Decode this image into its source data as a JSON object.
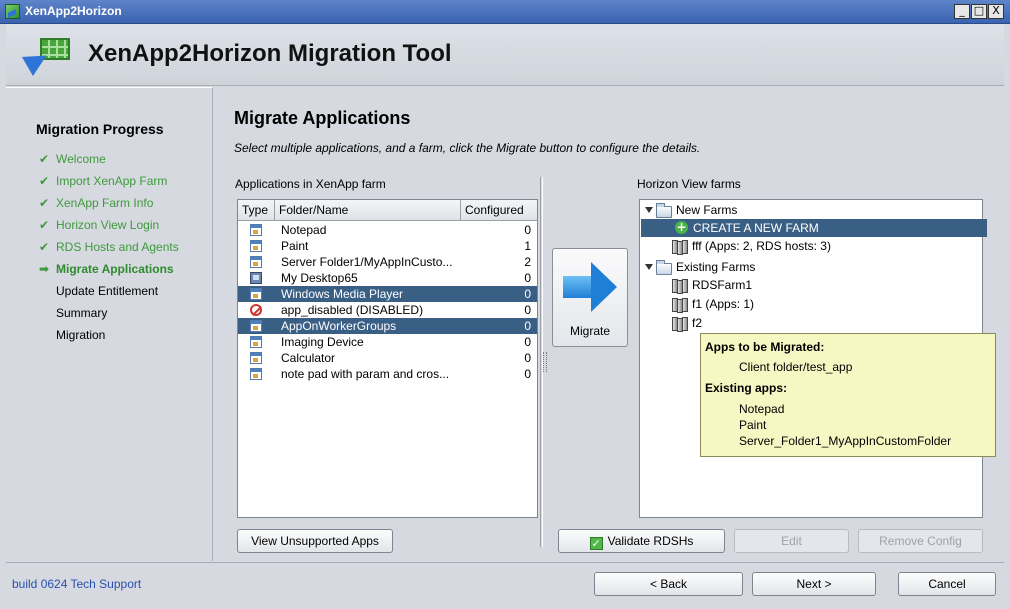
{
  "window": {
    "title": "XenApp2Horizon",
    "minimize": "_",
    "maximize": "□",
    "close": "X"
  },
  "header": {
    "title": "XenApp2Horizon Migration Tool"
  },
  "sidebar": {
    "heading": "Migration Progress",
    "steps": [
      {
        "label": "Welcome",
        "state": "done",
        "mark": "✔"
      },
      {
        "label": "Import XenApp Farm",
        "state": "done",
        "mark": "✔"
      },
      {
        "label": "XenApp Farm Info",
        "state": "done",
        "mark": "✔"
      },
      {
        "label": "Horizon View Login",
        "state": "done",
        "mark": "✔"
      },
      {
        "label": "RDS Hosts and Agents",
        "state": "done",
        "mark": "✔"
      },
      {
        "label": "Migrate Applications",
        "state": "current",
        "mark": "➡"
      },
      {
        "label": "Update Entitlement",
        "state": "pending",
        "mark": ""
      },
      {
        "label": "Summary",
        "state": "pending",
        "mark": ""
      },
      {
        "label": "Migration",
        "state": "pending",
        "mark": ""
      }
    ]
  },
  "main": {
    "title": "Migrate Applications",
    "subtitle": "Select multiple applications, and a farm, click the Migrate button to configure the details.",
    "apps_label": "Applications in XenApp farm",
    "farms_label": "Horizon View farms",
    "columns": {
      "type": "Type",
      "name": "Folder/Name",
      "configured": "Configured"
    },
    "apps": [
      {
        "name": "Notepad",
        "configured": "0",
        "icon": "app-icon",
        "selected": false
      },
      {
        "name": "Paint",
        "configured": "1",
        "icon": "app-icon",
        "selected": false
      },
      {
        "name": "Server Folder1/MyAppInCusto...",
        "configured": "2",
        "icon": "app-icon",
        "selected": false
      },
      {
        "name": "My Desktop65",
        "configured": "0",
        "icon": "desktop-icon",
        "selected": false
      },
      {
        "name": "Windows Media Player",
        "configured": "0",
        "icon": "app-icon",
        "selected": true
      },
      {
        "name": "app_disabled (DISABLED)",
        "configured": "0",
        "icon": "disabled-icon",
        "selected": false
      },
      {
        "name": "AppOnWorkerGroups",
        "configured": "0",
        "icon": "app-icon",
        "selected": true
      },
      {
        "name": "Imaging Device",
        "configured": "0",
        "icon": "app-icon",
        "selected": false
      },
      {
        "name": "Calculator",
        "configured": "0",
        "icon": "app-icon",
        "selected": false
      },
      {
        "name": "note pad with param and cros...",
        "configured": "0",
        "icon": "app-icon",
        "selected": false
      }
    ],
    "migrate_label": "Migrate",
    "tree": {
      "new_farms": "New Farms",
      "create_new": "CREATE A NEW FARM",
      "fff": "fff (Apps: 2, RDS hosts: 3)",
      "existing_farms": "Existing Farms",
      "rdsfarm1": "RDSFarm1",
      "f1": "f1 (Apps: 1)",
      "f2": "f2"
    },
    "tooltip": {
      "to_migrate_heading": "Apps to be Migrated:",
      "to_migrate": [
        "Client folder/test_app"
      ],
      "existing_heading": "Existing apps:",
      "existing": [
        "Notepad",
        "Paint",
        "Server_Folder1_MyAppInCustomFolder"
      ]
    },
    "buttons": {
      "view_unsupported": "View Unsupported Apps",
      "validate": "Validate RDSHs",
      "edit": "Edit",
      "remove_config": "Remove Config"
    }
  },
  "footer": {
    "build": "build 0624 Tech Support",
    "back": "< Back",
    "next": "Next >",
    "cancel": "Cancel"
  },
  "colors": {
    "selection": "#3a5f85",
    "done_step": "#3e9a3c",
    "tooltip_bg": "#f7f7c4"
  }
}
